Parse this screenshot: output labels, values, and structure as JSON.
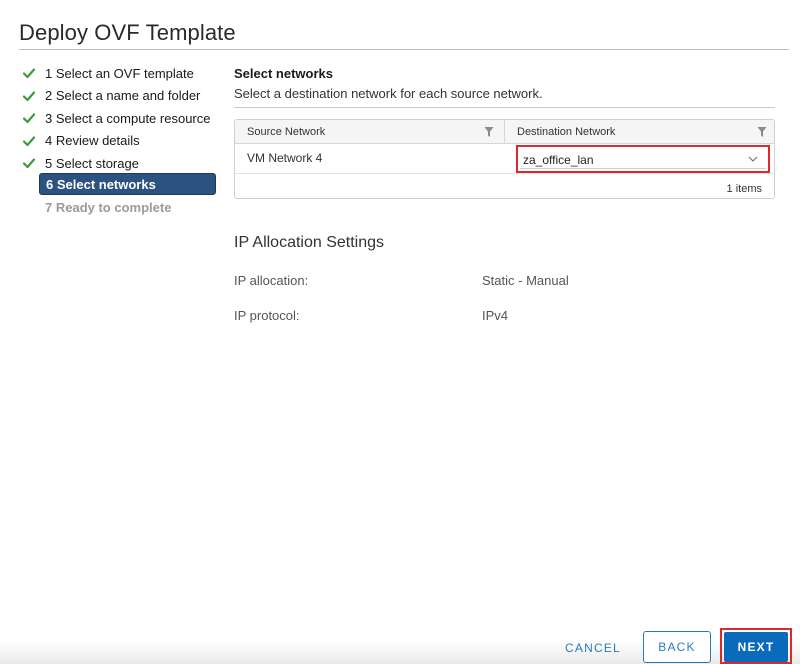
{
  "window": {
    "title": "Deploy OVF Template"
  },
  "steps": [
    {
      "label": "1 Select an OVF template",
      "state": "done"
    },
    {
      "label": "2 Select a name and folder",
      "state": "done"
    },
    {
      "label": "3 Select a compute resource",
      "state": "done"
    },
    {
      "label": "4 Review details",
      "state": "done"
    },
    {
      "label": "5 Select storage",
      "state": "done"
    },
    {
      "label": "6 Select networks",
      "state": "current"
    },
    {
      "label": "7 Ready to complete",
      "state": "disabled"
    }
  ],
  "networks": {
    "title": "Select networks",
    "description": "Select a destination network for each source network.",
    "columns": {
      "source": "Source Network",
      "destination": "Destination Network"
    },
    "rows": [
      {
        "source": "VM Network 4",
        "destination": "za_office_lan"
      }
    ],
    "footer": "1 items"
  },
  "ip_settings": {
    "title": "IP Allocation Settings",
    "allocation_label": "IP allocation:",
    "allocation_value": "Static - Manual",
    "protocol_label": "IP protocol:",
    "protocol_value": "IPv4"
  },
  "buttons": {
    "cancel": "CANCEL",
    "back": "BACK",
    "next": "NEXT"
  },
  "colors": {
    "check_green": "#3c9b3c",
    "current_step_bg": "#2b5281",
    "primary_blue": "#0b6aba",
    "link_blue": "#2a7cb8",
    "highlight_red": "#e0282c"
  },
  "icons": {
    "done": "check-icon",
    "filter": "filter-icon",
    "dropdown": "chevron-down-icon"
  }
}
